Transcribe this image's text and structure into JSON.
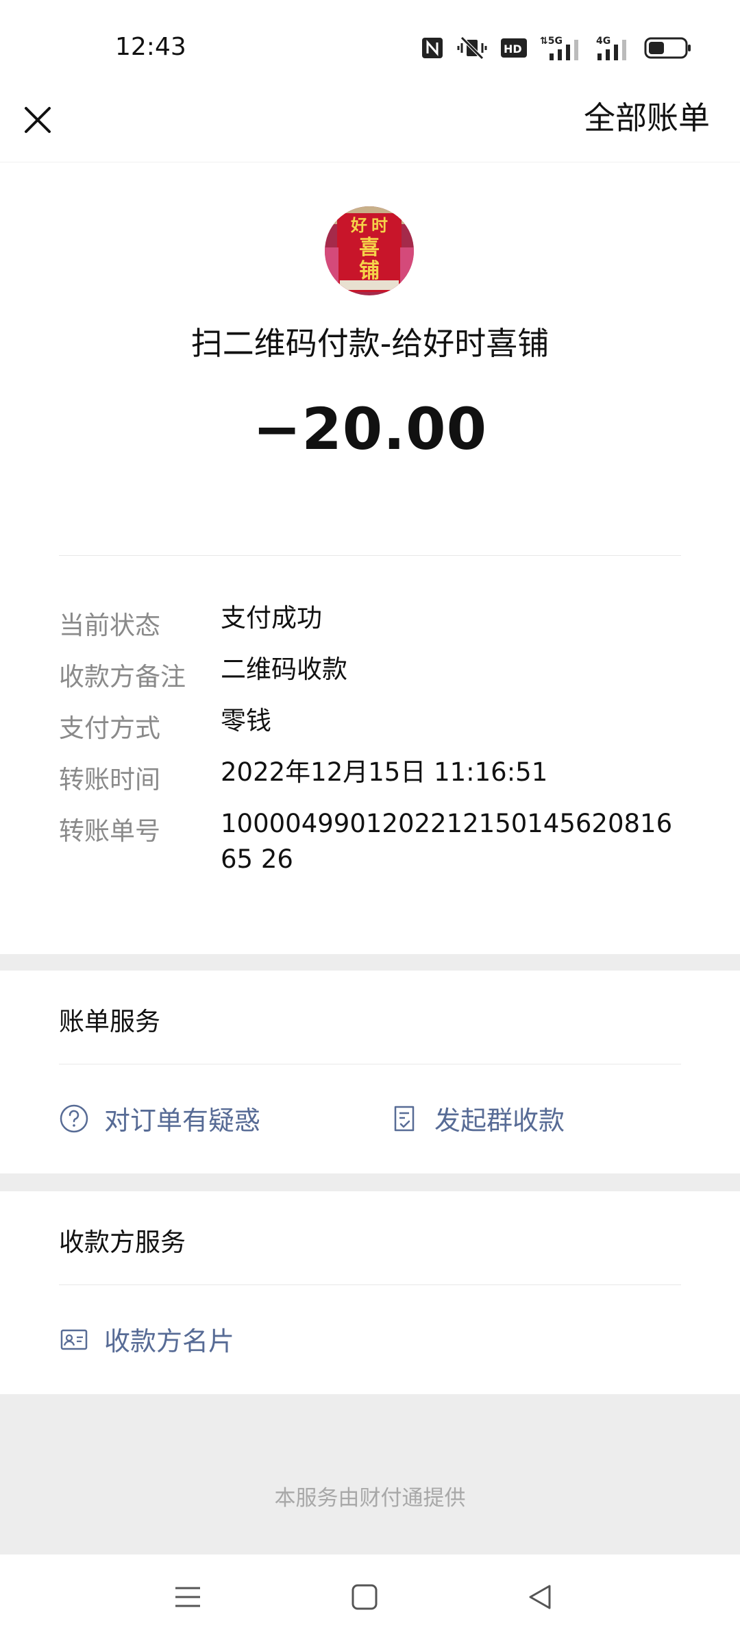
{
  "status_bar": {
    "time": "12:43",
    "icons": [
      "nfc-icon",
      "vibrate-off-icon",
      "hd-icon",
      "5g-signal-icon",
      "4g-signal-icon",
      "battery-icon"
    ]
  },
  "nav": {
    "close_icon": "close-icon",
    "all_bills_label": "全部账单"
  },
  "transaction": {
    "merchant_title": "扫二维码付款-给好时喜铺",
    "amount": "−20.00",
    "avatar_text": [
      "好",
      "时",
      "喜",
      "铺"
    ]
  },
  "details": [
    {
      "label": "当前状态",
      "value": "支付成功"
    },
    {
      "label": "收款方备注",
      "value": "二维码收款"
    },
    {
      "label": "支付方式",
      "value": "零钱"
    },
    {
      "label": "转账时间",
      "value": "2022年12月15日 11:16:51"
    },
    {
      "label": "转账单号",
      "value": "100004990120221215014562081665 26"
    }
  ],
  "bill_service": {
    "title": "账单服务",
    "actions": [
      {
        "label": "对订单有疑惑",
        "icon": "question-circle-icon"
      },
      {
        "label": "发起群收款",
        "icon": "document-check-icon"
      }
    ]
  },
  "payee_service": {
    "title": "收款方服务",
    "actions": [
      {
        "label": "收款方名片",
        "icon": "contact-card-icon"
      }
    ]
  },
  "footer": {
    "provider_text": "本服务由财付通提供"
  },
  "system_nav": [
    "menu-icon",
    "home-icon",
    "back-icon"
  ],
  "colors": {
    "link": "#576b95",
    "background": "#ededed",
    "label": "#8a8a8a"
  }
}
